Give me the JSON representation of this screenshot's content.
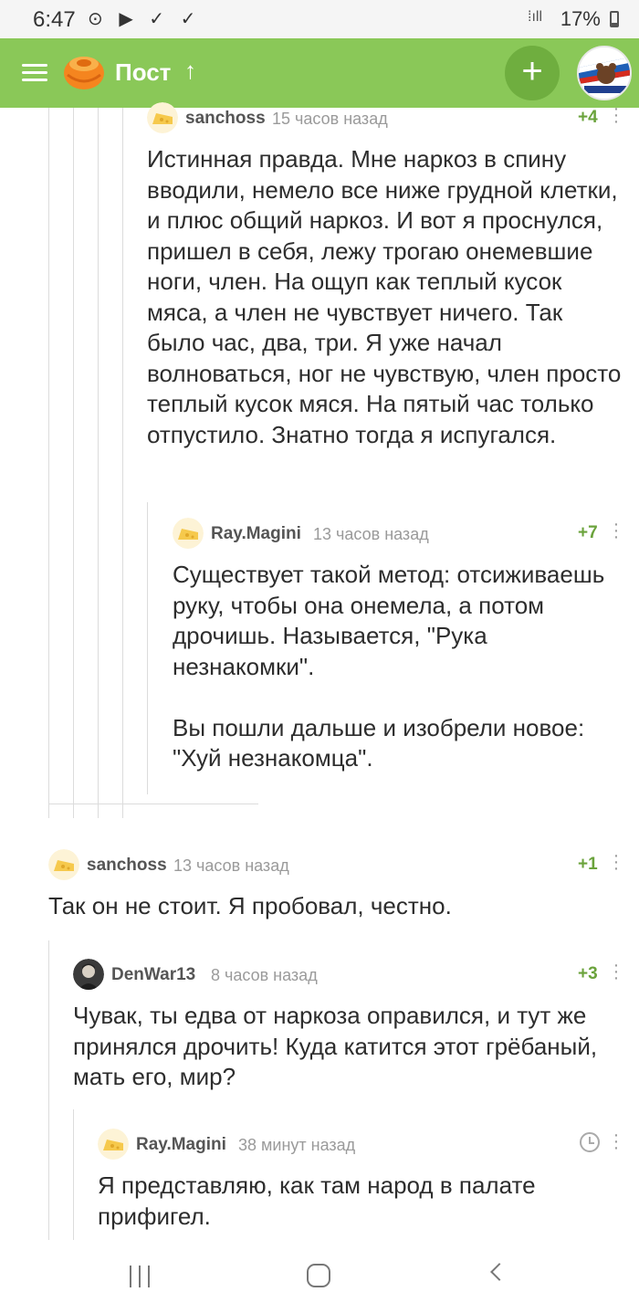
{
  "status": {
    "time": "6:47",
    "left_icons": "⊙ ▶ ✓ ✓",
    "battery": "17%",
    "network": "⁞ıll"
  },
  "header": {
    "title": "Пост",
    "up_arrow": "↑",
    "add": "+"
  },
  "comments": [
    {
      "user": "sanchoss",
      "time": "15 часов назад",
      "rating": "+4",
      "text": "Истинная правда. Мне наркоз в спину вводили, немело все ниже грудной клетки, и плюс общий наркоз. И вот я проснулся, пришел в себя, лежу трогаю онемевшие ноги, член. На ощуп как теплый кусок мяса, а член не чувствует ничего. Так было час, два, три. Я уже начал волноваться, ног не чувствую, член просто теплый кусок мяся. На пятый час только отпустило. Знатно тогда я испугался."
    },
    {
      "user": "Ray.Magini",
      "time": "13 часов назад",
      "rating": "+7",
      "text": "Существует такой метод: отсиживаешь руку, чтобы она онемела, а потом дрочишь. Называется, \"Рука незнакомки\".\n\nВы пошли дальше и изобрели новое: \"Хуй незнакомца\"."
    },
    {
      "user": "sanchoss",
      "time": "13 часов назад",
      "rating": "+1",
      "text": "Так он не стоит. Я пробовал, честно."
    },
    {
      "user": "DenWar13",
      "time": "8 часов назад",
      "rating": "+3",
      "text": "Чувак, ты едва от наркоза оправился, и тут же принялся дрочить! Куда катится этот грёбаный, мать его, мир?"
    },
    {
      "user": "Ray.Magini",
      "time": "38 минут назад",
      "rating": "",
      "text": "Я представляю, как там народ в палате прифигел."
    }
  ],
  "colors": {
    "header_bg": "#8ac858",
    "rating": "#6ba33c"
  },
  "icons": [
    "menu-icon",
    "logo-icon",
    "up-arrow-icon",
    "plus-icon",
    "more-icon",
    "clock-icon"
  ]
}
